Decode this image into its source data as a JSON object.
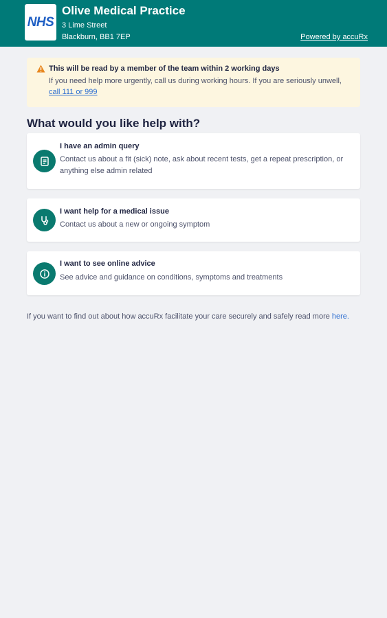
{
  "header": {
    "logo_text": "NHS",
    "practice_name": "Olive Medical Practice",
    "address_line1": "3 Lime Street",
    "address_line2": "Blackburn, BB1 7EP",
    "powered_by": "Powered by accuRx"
  },
  "notice": {
    "title": "This will be read by a member of the team within 2 working days",
    "body": "If you need help more urgently, call us during working hours. If you are seriously unwell,",
    "link": "call 111 or 999",
    "icon": "warning-icon"
  },
  "main": {
    "heading": "What would you like help with?",
    "options": [
      {
        "title": "I have an admin query",
        "description": "Contact us about a fit (sick) note, ask about recent tests, get a repeat prescription, or anything else admin related",
        "icon": "clipboard-icon"
      },
      {
        "title": "I want help for a medical issue",
        "description": "Contact us about a new or ongoing symptom",
        "icon": "stethoscope-icon"
      },
      {
        "title": "I want to see online advice",
        "description": "See advice and guidance on conditions, symptoms and treatments",
        "icon": "info-icon"
      }
    ]
  },
  "footer": {
    "text": "If you want to find out about how accuRx facilitate your care securely and safely read more",
    "link": "here."
  },
  "colors": {
    "header_bg": "#007a78",
    "notice_bg": "#fdf6e0",
    "icon_bg": "#0a7a6f",
    "link": "#2e6fd1",
    "warning": "#e8871e"
  }
}
